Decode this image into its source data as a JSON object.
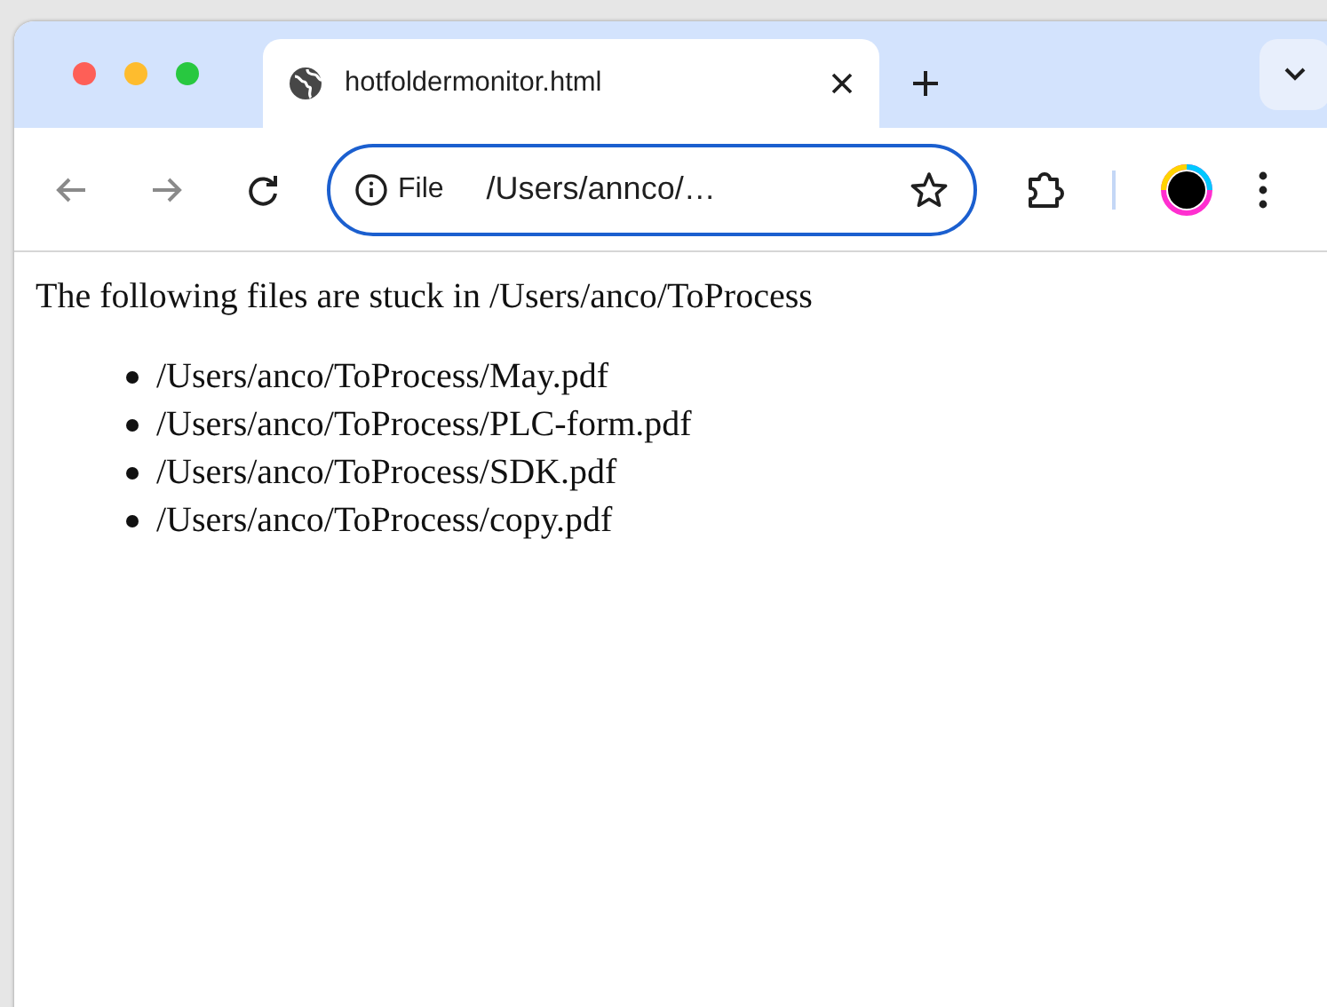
{
  "tabs": [
    {
      "title": "hotfoldermonitor.html",
      "selected": true
    }
  ],
  "address_bar": {
    "scheme": "File",
    "value": "/Users/annco/…",
    "focused": true
  },
  "page": {
    "text": "The following files are stuck in /Users/anco/ToProcess",
    "items": [
      "/Users/anco/ToProcess/May.pdf",
      "/Users/anco/ToProcess/PLC-form.pdf",
      "/Users/anco/ToProcess/SDK.pdf",
      "/Users/anco/ToProcess/copy.pdf"
    ]
  }
}
